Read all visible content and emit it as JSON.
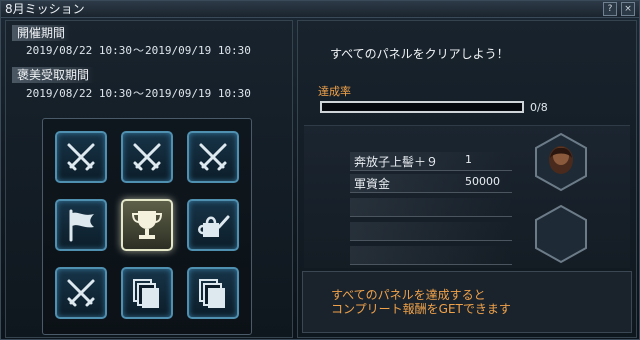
{
  "window": {
    "title": "8月ミッション",
    "help_icon": "help-icon",
    "close_icon": "close-icon",
    "close_glyph": "×",
    "help_glyph": "?"
  },
  "event_period": {
    "label": "開催期間",
    "start": "2019/08/22 10:30",
    "separator": "～",
    "end": "2019/09/19 10:30"
  },
  "reward_period": {
    "label": "褒美受取期間",
    "start": "2019/08/22 10:30",
    "separator": "～",
    "end": "2019/09/19 10:30"
  },
  "panels": [
    {
      "icon": "crossed-swords-icon",
      "active": false
    },
    {
      "icon": "crossed-swords-icon",
      "active": false
    },
    {
      "icon": "crossed-swords-icon",
      "active": false
    },
    {
      "icon": "flag-icon",
      "active": false
    },
    {
      "icon": "trophy-icon",
      "active": true
    },
    {
      "icon": "watering-can-icon",
      "active": false
    },
    {
      "icon": "crossed-swords-icon",
      "active": false
    },
    {
      "icon": "cards-icon",
      "active": false
    },
    {
      "icon": "cards-icon",
      "active": false
    }
  ],
  "mission": {
    "description": "すべてのパネルをクリアしよう！",
    "progress_label": "達成率",
    "progress_current": 0,
    "progress_total": 8,
    "progress_text": "0/8"
  },
  "rewards": [
    {
      "name": "奔放子上髻＋９",
      "value": "1"
    },
    {
      "name": "軍資金",
      "value": "50000"
    },
    {
      "name": "",
      "value": ""
    },
    {
      "name": "",
      "value": ""
    },
    {
      "name": "",
      "value": ""
    }
  ],
  "reward_slots": [
    {
      "icon": "hairstyle-item-icon",
      "filled": true
    },
    {
      "icon": "empty-slot-icon",
      "filled": false
    }
  ],
  "note": {
    "line1": "すべてのパネルを達成すると",
    "line2": "コンプリート報酬をGETできます"
  },
  "colors": {
    "accent_orange": "#f0a24a",
    "panel_glow": "#4f8fb0",
    "active_panel": "#e4e8c8"
  }
}
